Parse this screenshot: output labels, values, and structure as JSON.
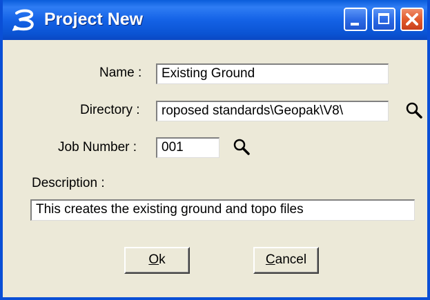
{
  "window": {
    "title": "Project New",
    "app_icon": "microstation-icon",
    "controls": {
      "minimize_icon": "minimize-icon",
      "maximize_icon": "maximize-icon",
      "close_icon": "close-icon"
    }
  },
  "form": {
    "name_label": "Name :",
    "name_value": "Existing Ground",
    "directory_label": "Directory :",
    "directory_value": "roposed standards\\Geopak\\V8\\",
    "directory_browse_icon": "search-icon",
    "job_number_label": "Job Number :",
    "job_number_value": "001",
    "job_number_browse_icon": "search-icon",
    "description_label": "Description :",
    "description_value": "This creates the existing ground and topo files"
  },
  "buttons": {
    "ok": {
      "mnemonic": "O",
      "rest": "k"
    },
    "cancel": {
      "mnemonic": "C",
      "rest": "ancel"
    }
  },
  "colors": {
    "titlebar": "#0a5ddb",
    "dialog_bg": "#ece9d8",
    "close_button": "#e25a2c"
  }
}
